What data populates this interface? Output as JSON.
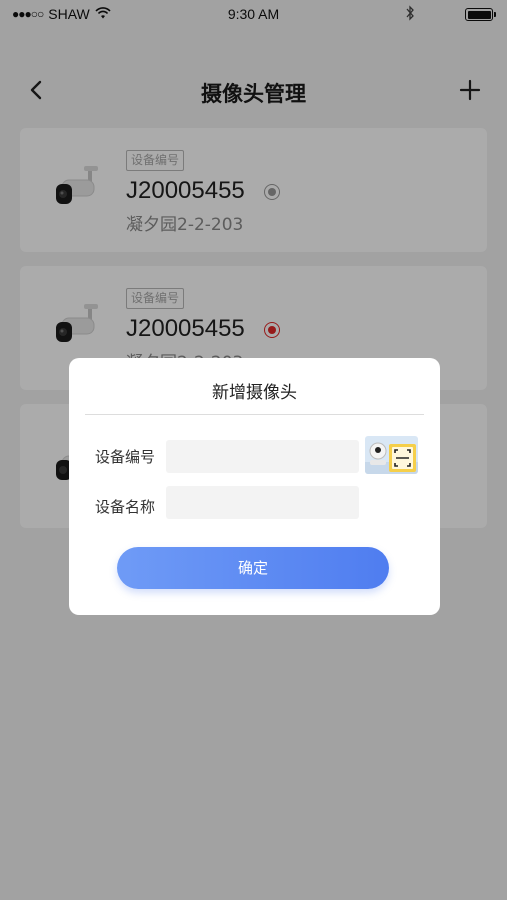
{
  "status_bar": {
    "carrier": "SHAW",
    "time": "9:30 AM"
  },
  "nav": {
    "title": "摄像头管理"
  },
  "cameras": [
    {
      "tag": "设备编号",
      "id": "J20005455",
      "location": "凝夕园2-2-203",
      "online": false
    },
    {
      "tag": "设备编号",
      "id": "J20005455",
      "location": "凝夕园2-2-203",
      "online": true
    }
  ],
  "dialog": {
    "title": "新增摄像头",
    "device_id_label": "设备编号",
    "device_id_value": "",
    "device_name_label": "设备名称",
    "device_name_value": "",
    "confirm_label": "确定"
  },
  "colors": {
    "accent": "#5a86f2",
    "status_active": "#e02828",
    "status_inactive": "#999999"
  }
}
